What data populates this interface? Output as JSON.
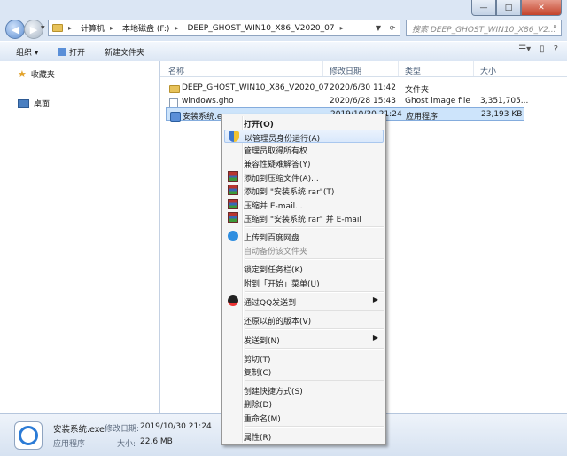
{
  "window": {
    "caption_min": "—",
    "caption_max": "□",
    "caption_close": "✕"
  },
  "address": {
    "back_icon": "◀",
    "forward_icon": "▶",
    "crumbs": [
      "计算机",
      "本地磁盘 (F:)",
      "DEEP_GHOST_WIN10_X86_V2020_07"
    ],
    "search_placeholder": "搜索 DEEP_GHOST_WIN10_X86_V2..."
  },
  "toolbar": {
    "organize": "组织 ▾",
    "open": "打开",
    "new_folder": "新建文件夹"
  },
  "nav": {
    "favorites": "收藏夹",
    "desktop": "桌面"
  },
  "columns": [
    "名称",
    "修改日期",
    "类型",
    "大小"
  ],
  "files": [
    {
      "name": "DEEP_GHOST_WIN10_X86_V2020_07",
      "date": "2020/6/30 11:42",
      "type": "文件夹",
      "size": "",
      "icon": "folder-icon"
    },
    {
      "name": "windows.gho",
      "date": "2020/6/28 15:43",
      "type": "Ghost image file",
      "size": "3,351,705...",
      "icon": "file-icon"
    },
    {
      "name": "安装系统.exe",
      "date": "2019/10/30 21:24",
      "type": "应用程序",
      "size": "23,193 KB",
      "icon": "exe-icon"
    }
  ],
  "details": {
    "name": "安装系统.exe",
    "modified_label": "修改日期:",
    "modified_value": "2019/10/30 21:24",
    "type": "应用程序",
    "size_label": "大小:",
    "size_value": "22.6 MB"
  },
  "menu": {
    "items": [
      {
        "label": "打开(O)",
        "bold": true
      },
      {
        "label": "以管理员身份运行(A)",
        "icon": "shield-icon",
        "highlight": true
      },
      {
        "label": "管理员取得所有权"
      },
      {
        "label": "兼容性疑难解答(Y)"
      },
      {
        "label": "添加到压缩文件(A)...",
        "icon": "winrar-icon"
      },
      {
        "label": "添加到 \"安装系统.rar\"(T)",
        "icon": "winrar-icon"
      },
      {
        "label": "压缩并 E-mail...",
        "icon": "winrar-icon"
      },
      {
        "label": "压缩到 \"安装系统.rar\" 并 E-mail",
        "icon": "winrar-icon"
      },
      {
        "label": "上传到百度网盘",
        "icon": "cloud-icon"
      },
      {
        "label": "自动备份该文件夹",
        "disabled": true
      },
      {
        "label": "锁定到任务栏(K)"
      },
      {
        "label": "附到「开始」菜单(U)"
      },
      {
        "label": "通过QQ发送到",
        "icon": "qq-icon",
        "submenu": true
      },
      {
        "label": "还原以前的版本(V)"
      },
      {
        "label": "发送到(N)",
        "submenu": true
      },
      {
        "label": "剪切(T)"
      },
      {
        "label": "复制(C)"
      },
      {
        "label": "创建快捷方式(S)"
      },
      {
        "label": "删除(D)"
      },
      {
        "label": "重命名(M)"
      },
      {
        "label": "属性(R)"
      }
    ],
    "submenu_arrow": "▶"
  }
}
